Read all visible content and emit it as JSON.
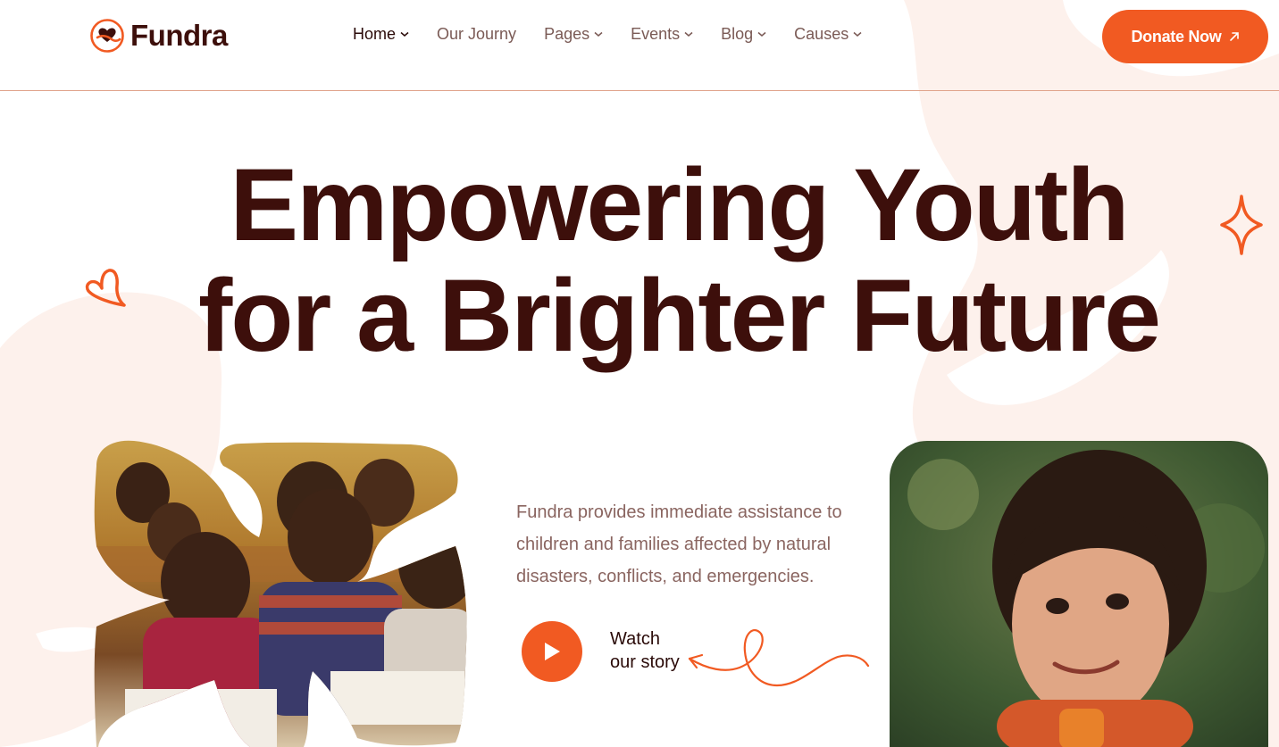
{
  "brand": {
    "name": "Fundra"
  },
  "nav": {
    "items": [
      {
        "label": "Home",
        "dropdown": true,
        "active": true
      },
      {
        "label": "Our Journy",
        "dropdown": false,
        "active": false
      },
      {
        "label": "Pages",
        "dropdown": true,
        "active": false
      },
      {
        "label": "Events",
        "dropdown": true,
        "active": false
      },
      {
        "label": "Blog",
        "dropdown": true,
        "active": false
      },
      {
        "label": "Causes",
        "dropdown": true,
        "active": false
      }
    ]
  },
  "header": {
    "cta_label": "Donate Now",
    "cta_icon": "arrow-up-right-icon"
  },
  "hero": {
    "title_line1": "Empowering Youth",
    "title_line2": "for a Brighter Future",
    "description": "Fundra provides immediate assistance to children and families affected by natural disasters, conflicts, and emergencies.",
    "watch_line1": "Watch",
    "watch_line2": "our story"
  },
  "colors": {
    "accent": "#f15a22",
    "heading": "#3d0f0b",
    "body_text": "#8a6560",
    "blob": "#fdf1ec"
  }
}
